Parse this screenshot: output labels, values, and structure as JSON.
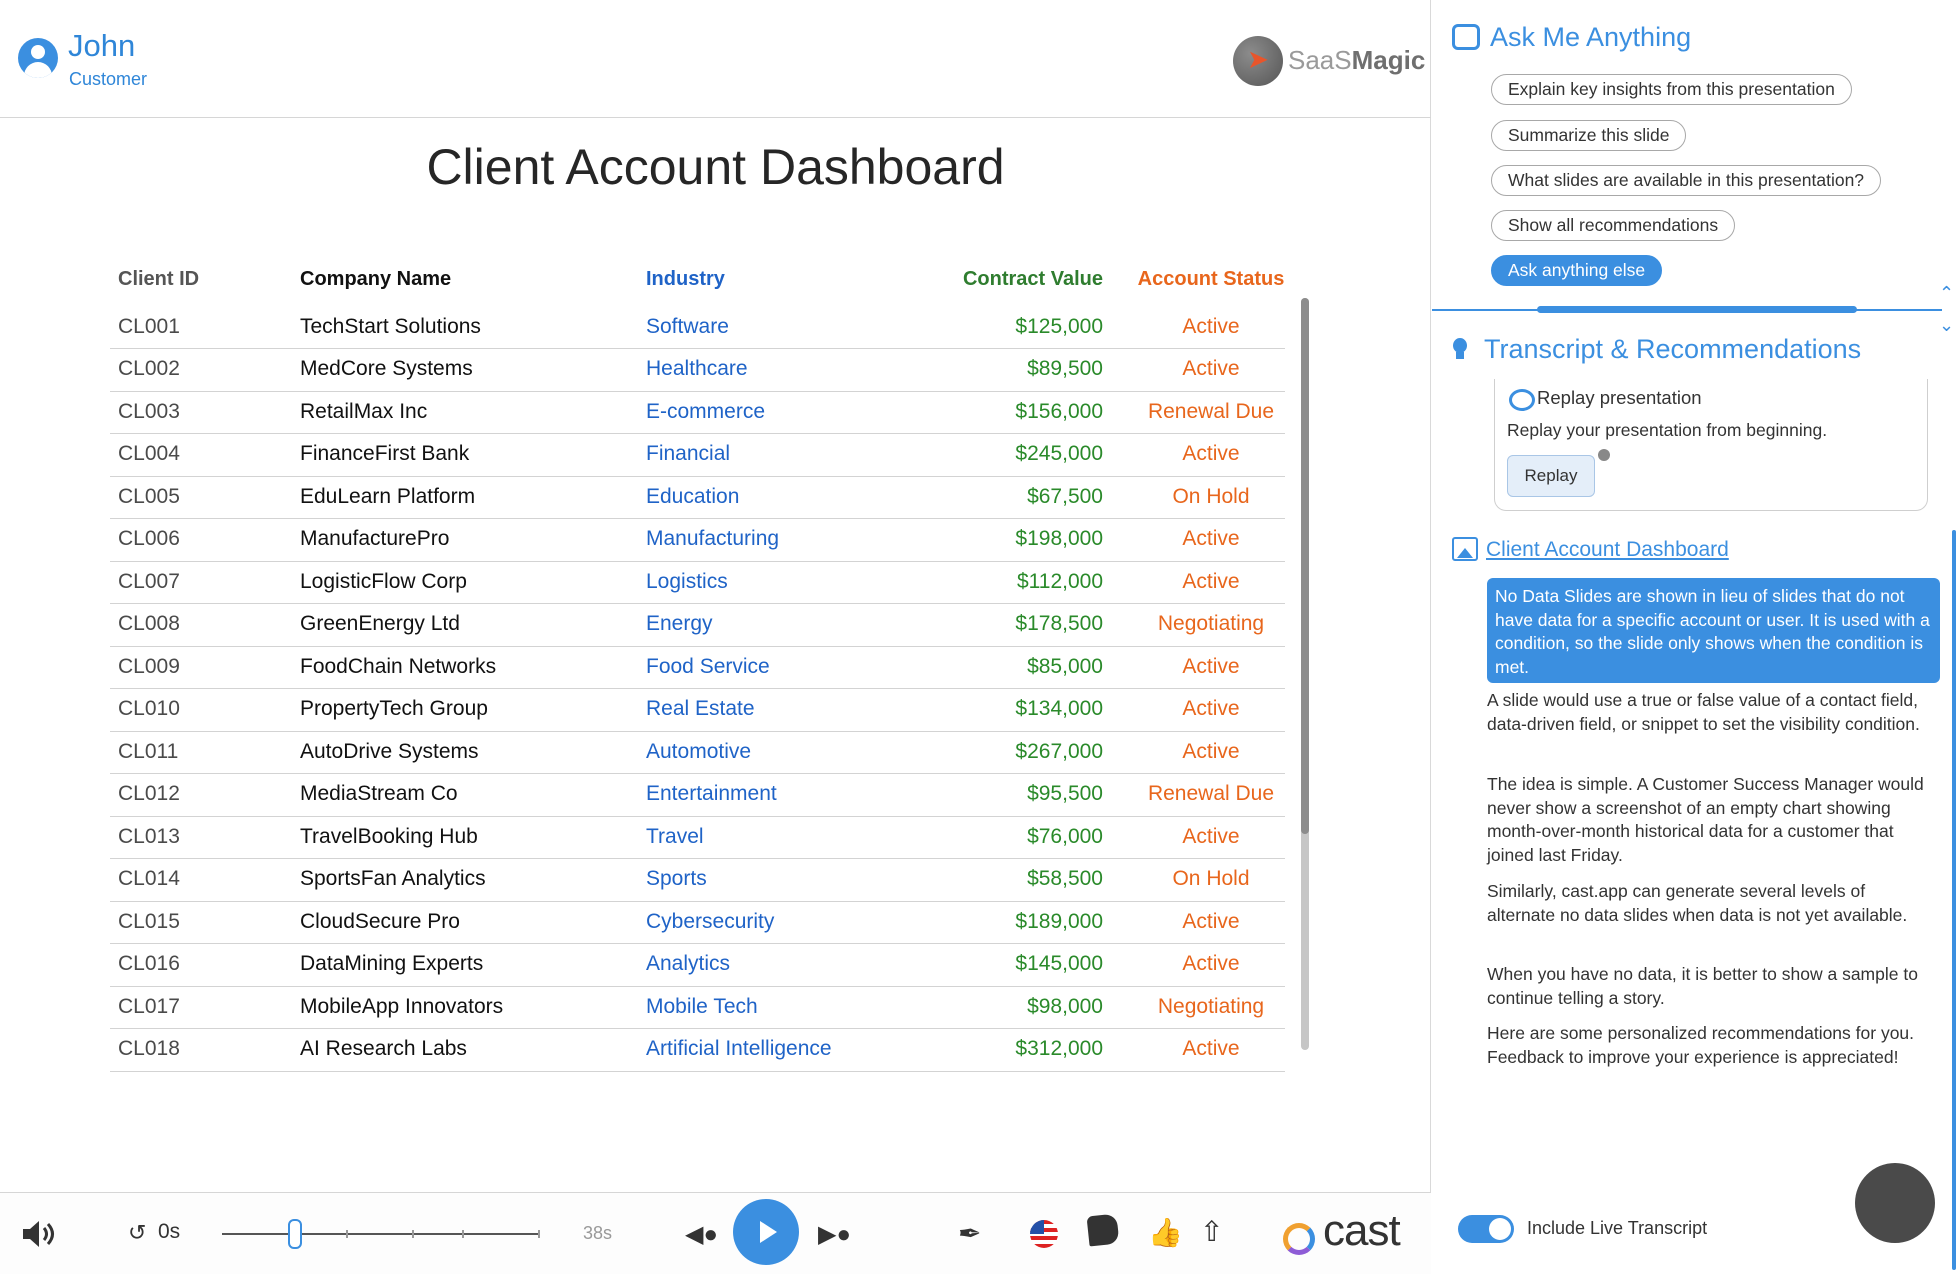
{
  "header": {
    "user_name": "John",
    "user_role": "Customer",
    "brand_light": "SaaS",
    "brand_bold": "Magic"
  },
  "main": {
    "title": "Client Account Dashboard",
    "columns": [
      "Client ID",
      "Company Name",
      "Industry",
      "Contract Value",
      "Account Status"
    ],
    "rows": [
      [
        "CL001",
        "TechStart Solutions",
        "Software",
        "$125,000",
        "Active"
      ],
      [
        "CL002",
        "MedCore Systems",
        "Healthcare",
        "$89,500",
        "Active"
      ],
      [
        "CL003",
        "RetailMax Inc",
        "E-commerce",
        "$156,000",
        "Renewal Due"
      ],
      [
        "CL004",
        "FinanceFirst Bank",
        "Financial",
        "$245,000",
        "Active"
      ],
      [
        "CL005",
        "EduLearn Platform",
        "Education",
        "$67,500",
        "On Hold"
      ],
      [
        "CL006",
        "ManufacturePro",
        "Manufacturing",
        "$198,000",
        "Active"
      ],
      [
        "CL007",
        "LogisticFlow Corp",
        "Logistics",
        "$112,000",
        "Active"
      ],
      [
        "CL008",
        "GreenEnergy Ltd",
        "Energy",
        "$178,500",
        "Negotiating"
      ],
      [
        "CL009",
        "FoodChain Networks",
        "Food Service",
        "$85,000",
        "Active"
      ],
      [
        "CL010",
        "PropertyTech Group",
        "Real Estate",
        "$134,000",
        "Active"
      ],
      [
        "CL011",
        "AutoDrive Systems",
        "Automotive",
        "$267,000",
        "Active"
      ],
      [
        "CL012",
        "MediaStream Co",
        "Entertainment",
        "$95,500",
        "Renewal Due"
      ],
      [
        "CL013",
        "TravelBooking Hub",
        "Travel",
        "$76,000",
        "Active"
      ],
      [
        "CL014",
        "SportsFan Analytics",
        "Sports",
        "$58,500",
        "On Hold"
      ],
      [
        "CL015",
        "CloudSecure Pro",
        "Cybersecurity",
        "$189,000",
        "Active"
      ],
      [
        "CL016",
        "DataMining Experts",
        "Analytics",
        "$145,000",
        "Active"
      ],
      [
        "CL017",
        "MobileApp Innovators",
        "Mobile Tech",
        "$98,000",
        "Negotiating"
      ],
      [
        "CL018",
        "AI Research Labs",
        "Artificial Intelligence",
        "$312,000",
        "Active"
      ]
    ]
  },
  "player": {
    "time_start": "0s",
    "time_end": "38s",
    "cast_label": "cast",
    "progress_fraction": 0.2
  },
  "assistant": {
    "title": "Ask Me Anything",
    "suggestions": [
      "Explain key insights from this presentation",
      "Summarize this slide",
      "What slides are available in this presentation?",
      "Show all recommendations",
      "Ask anything else"
    ]
  },
  "transcript": {
    "title": "Transcript & Recommendations",
    "replay_title": "Replay presentation",
    "replay_text": "Replay your presentation from beginning.",
    "replay_button": "Replay",
    "slide_link": "Client Account Dashboard",
    "highlight": "No Data Slides are shown in lieu of slides that do not have data for a specific account or user. It is used with a condition, so the slide only shows when the condition is met.",
    "paragraphs": [
      "A slide would use a true or false value of a contact field, data-driven field, or snippet to set the visibility condition.",
      "The idea is simple. A Customer Success Manager would never show a screenshot of an empty chart showing month-over-month historical data for a customer that joined last Friday.",
      "Similarly, cast.app can generate several levels of alternate no data slides when data is not yet available.",
      "When you have no data, it is better to show a sample to continue telling a story.",
      "Here are some personalized recommendations for you. Feedback to improve your experience is appreciated!"
    ],
    "toggle_label": "Include Live Transcript"
  },
  "colors": {
    "accent": "#3b8fe0",
    "industry": "#1f63c7",
    "value": "#2a8a2a",
    "status": "#e8661c"
  }
}
